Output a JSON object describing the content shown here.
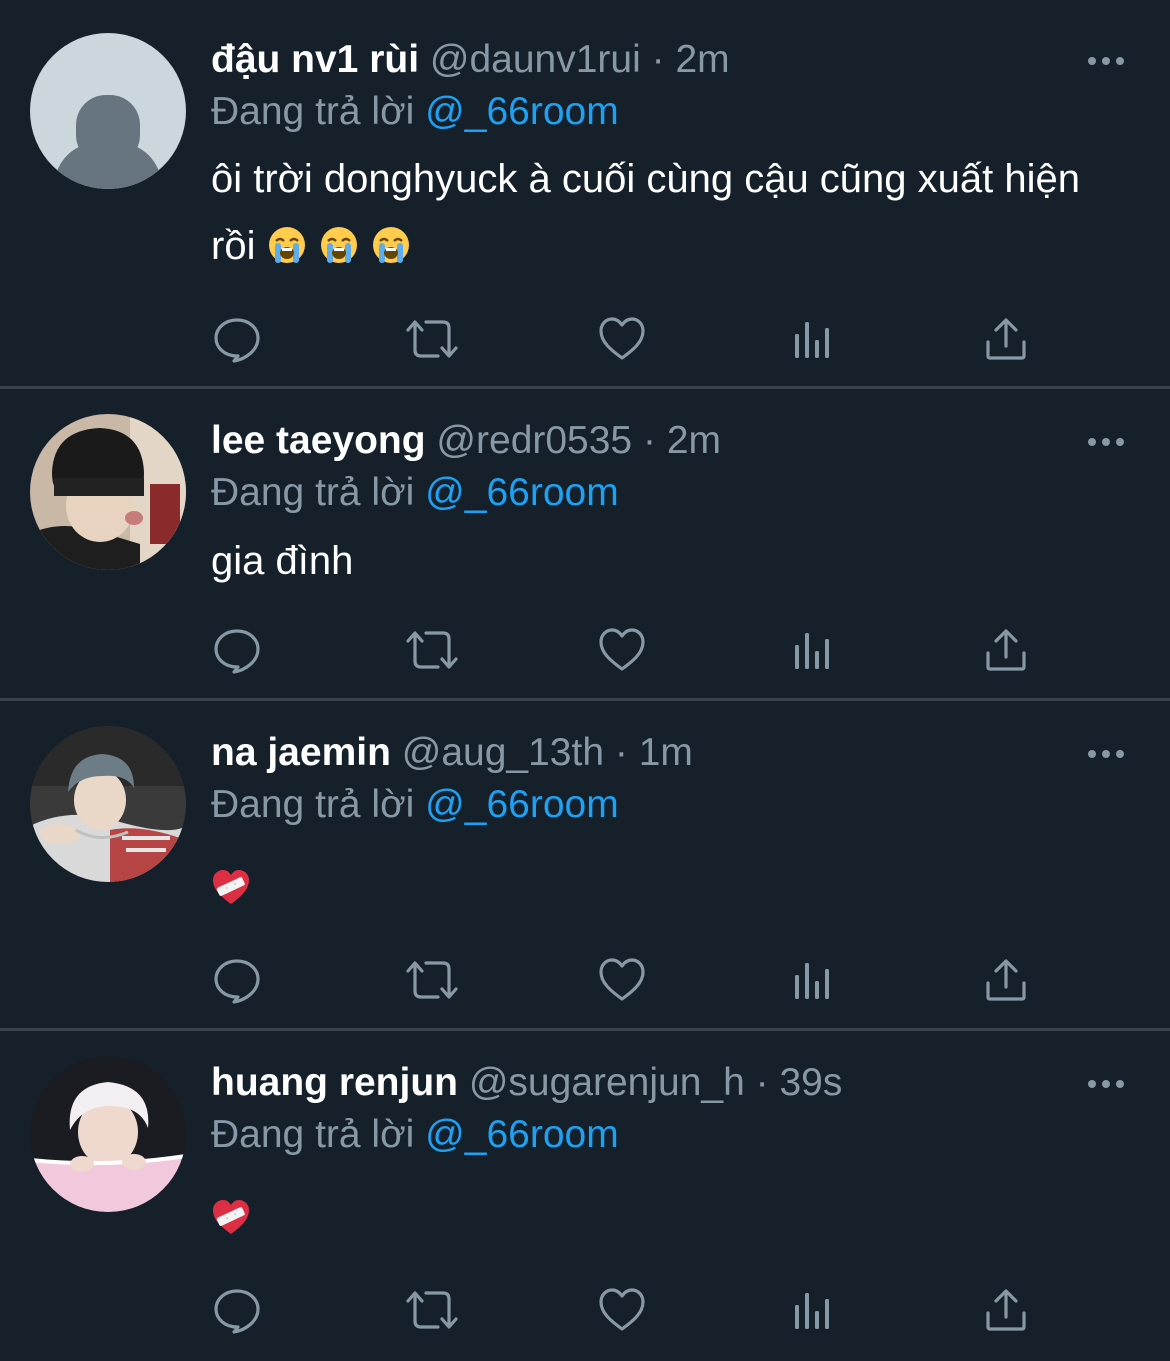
{
  "theme": {
    "background": "#15202b",
    "divider": "#38444d",
    "secondary_text": "#8899a6",
    "accent": "#1da1f2"
  },
  "tweets": [
    {
      "name": "đậu nv1 rùi",
      "handle": "@daunv1rui",
      "separator": "·",
      "time": "2m",
      "reply_prefix": "Đang trả lời",
      "reply_to": "@_66room",
      "text": "ôi trời donghyuck à cuối cùng cậu cũng xuất hiện rồi",
      "emojis": [
        "loudly-crying-face",
        "loudly-crying-face",
        "loudly-crying-face"
      ],
      "avatar": "default-avatar"
    },
    {
      "name": "lee taeyong",
      "handle": "@redr0535",
      "separator": "·",
      "time": "2m",
      "reply_prefix": "Đang trả lời",
      "reply_to": "@_66room",
      "text": "gia đình",
      "emojis": [],
      "avatar": "photo-black-beanie"
    },
    {
      "name": "na jaemin",
      "handle": "@aug_13th",
      "separator": "·",
      "time": "1m",
      "reply_prefix": "Đang trả lời",
      "reply_to": "@_66room",
      "text": "",
      "emojis": [
        "mending-heart"
      ],
      "avatar": "photo-gray-hair"
    },
    {
      "name": "huang renjun",
      "handle": "@sugarenjun_h",
      "separator": "·",
      "time": "39s",
      "reply_prefix": "Đang trả lời",
      "reply_to": "@_66room",
      "text": "",
      "emojis": [
        "mending-heart"
      ],
      "avatar": "photo-white-hair"
    }
  ],
  "action_icons": [
    "reply-icon",
    "retweet-icon",
    "like-icon",
    "analytics-icon",
    "share-icon"
  ]
}
